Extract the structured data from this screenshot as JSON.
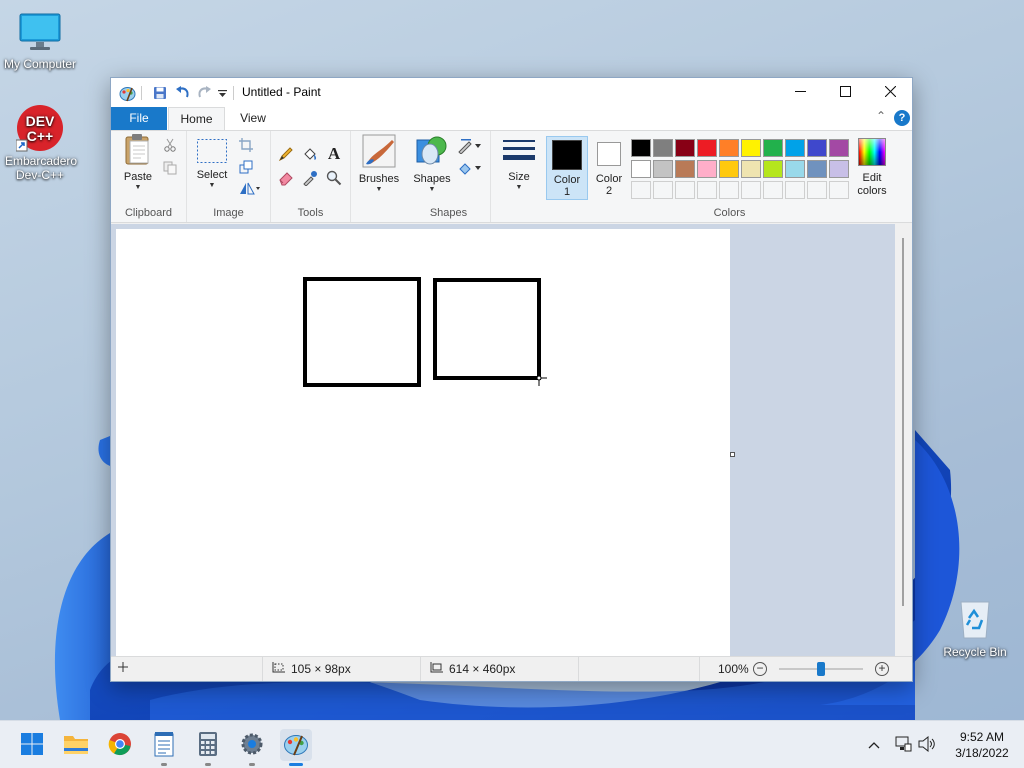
{
  "desktop": {
    "icons": [
      {
        "label": "My Computer",
        "icon": "monitor-icon"
      },
      {
        "label": "Embarcadero Dev-C++",
        "icon": "devcpp-icon",
        "badge_text": "DEV C++"
      },
      {
        "label": "Recycle Bin",
        "icon": "recycle-bin-icon"
      }
    ]
  },
  "window": {
    "title": "Untitled - Paint",
    "quick_access": [
      "paint-app-icon",
      "save-icon",
      "undo-icon",
      "redo-icon",
      "customize-dropdown-icon"
    ],
    "controls": [
      "minimize-icon",
      "maximize-icon",
      "close-icon"
    ]
  },
  "tabs": {
    "file": "File",
    "home": "Home",
    "view": "View",
    "active": "Home",
    "help": "?"
  },
  "ribbon": {
    "clipboard": {
      "group_label": "Clipboard",
      "paste_label": "Paste",
      "small": [
        "cut-icon",
        "copy-icon"
      ]
    },
    "image": {
      "group_label": "Image",
      "select_label": "Select",
      "small": [
        "crop-icon",
        "resize-icon",
        "rotate-icon"
      ]
    },
    "tools": {
      "group_label": "Tools",
      "items": [
        "pencil-icon",
        "fill-icon",
        "text-icon",
        "eraser-icon",
        "color-picker-icon",
        "magnifier-icon"
      ],
      "text_glyph": "A"
    },
    "brushes": {
      "label": "Brushes"
    },
    "shapes": {
      "group_label": "Shapes",
      "label": "Shapes",
      "small": [
        "outline-icon",
        "fill-shape-icon"
      ]
    },
    "size": {
      "label": "Size"
    },
    "colors": {
      "group_label": "Colors",
      "color1_label": "Color\n1",
      "color1_line1": "Color",
      "color1_line2": "1",
      "color2_line1": "Color",
      "color2_line2": "2",
      "color1": "#000000",
      "color2": "#ffffff",
      "palette_row1": [
        "#000000",
        "#7f7f7f",
        "#880015",
        "#ed1c24",
        "#ff7f27",
        "#fff200",
        "#22b14c",
        "#00a2e8",
        "#3f48cc",
        "#a349a4"
      ],
      "palette_row2": [
        "#ffffff",
        "#c3c3c3",
        "#b97a57",
        "#ffaec9",
        "#ffc90e",
        "#efe4b0",
        "#b5e61d",
        "#99d9ea",
        "#7092be",
        "#c8bfe7"
      ],
      "palette_row3_empty": 10,
      "edit_line1": "Edit",
      "edit_line2": "colors"
    }
  },
  "canvas": {
    "background": "#ffffff",
    "drawn_shapes": [
      "rectangle",
      "rectangle"
    ],
    "stroke_color": "#000000"
  },
  "status": {
    "selection_size": "105 × 98px",
    "image_size": "614 × 460px",
    "zoom": "100%",
    "zoom_fraction": 0.5
  },
  "taskbar": {
    "apps": [
      "start-icon",
      "file-explorer-icon",
      "chrome-icon",
      "notepad-icon",
      "calculator-icon",
      "settings-icon",
      "paint-icon"
    ],
    "running": [
      "notepad-icon",
      "calculator-icon",
      "settings-icon",
      "paint-icon"
    ],
    "active": "paint-icon",
    "tray": [
      "chevron-up-icon",
      "network-icon",
      "volume-icon"
    ],
    "time": "9:52 AM",
    "date": "3/18/2022"
  }
}
